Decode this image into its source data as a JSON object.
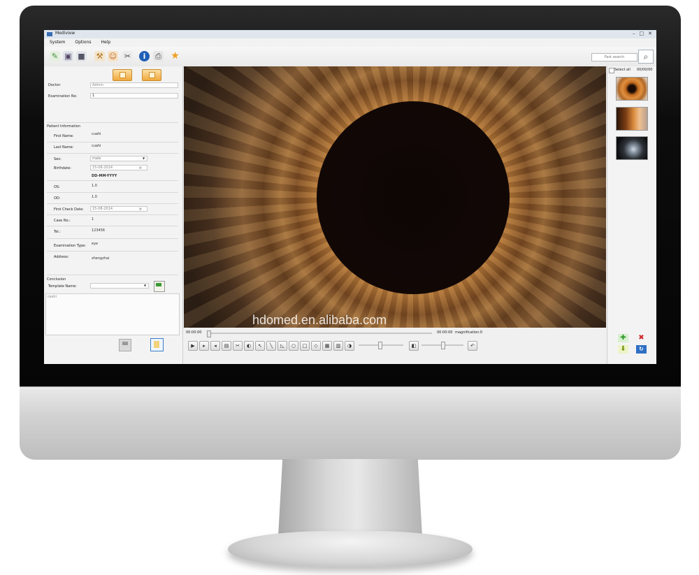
{
  "window": {
    "title": "Mediview",
    "controls": [
      "–",
      "□",
      "✕"
    ]
  },
  "menu": [
    "System",
    "Options",
    "Help"
  ],
  "toolbar_icons": [
    "open-icon",
    "camera-icon",
    "video-icon",
    "tools-icon",
    "user-icon",
    "scissors-icon",
    "info-icon",
    "print-icon",
    "star-icon"
  ],
  "search": {
    "placeholder": "Fast search"
  },
  "doctor": {
    "label": "Doctor:",
    "value": "Admin"
  },
  "exam_no": {
    "label": "Examination No:",
    "value": "1"
  },
  "patient": {
    "section_title": "Patient Information",
    "first_name": {
      "label": "First Name:",
      "value": "cuahi"
    },
    "last_name": {
      "label": "Last Name:",
      "value": "cuahi"
    },
    "sex": {
      "label": "Sex:",
      "value": "male"
    },
    "birthdate": {
      "label": "Birthdate:",
      "value": "15-08-2014",
      "format": "DD-MM-YYYY"
    },
    "os": {
      "label": "OS:",
      "value": "1.0"
    },
    "od": {
      "label": "OD:",
      "value": "1.0"
    },
    "first_check": {
      "label": "First Check Date:",
      "value": "15-08-2014"
    },
    "case_no": {
      "label": "Case No.:",
      "value": "1"
    },
    "tel": {
      "label": "Tel.:",
      "value": "123456"
    },
    "exam_type": {
      "label": "Examination Type:",
      "value": "eye"
    },
    "address": {
      "label": "Address:",
      "value": "zhengzhai"
    }
  },
  "conclusion": {
    "section_title": "Conclusion",
    "template_label": "Template Name:",
    "template_value": "",
    "text": "ceshi"
  },
  "viewer": {
    "watermark": "hdomed.en.alibaba.com"
  },
  "playback": {
    "start_time": "00:00:00",
    "end_time": "00:00:00",
    "magnification": "magnification:0"
  },
  "right_panel": {
    "select_all": "Select all",
    "date": "00/00/00"
  }
}
